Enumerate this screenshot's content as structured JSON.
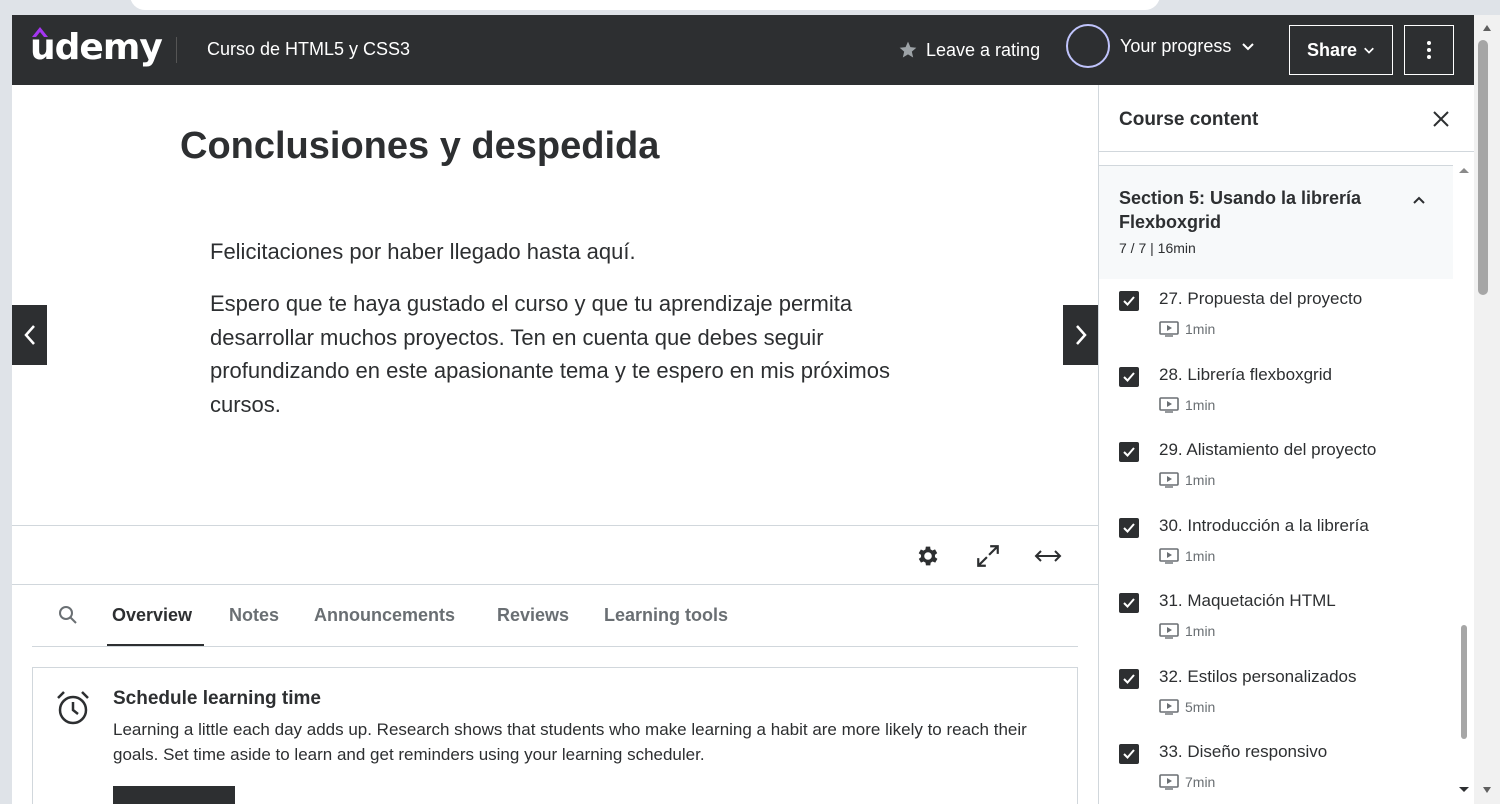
{
  "header": {
    "logo_text": "udemy",
    "course_title": "Curso de HTML5 y CSS3",
    "leave_rating": "Leave a rating",
    "your_progress": "Your progress",
    "share": "Share"
  },
  "lecture": {
    "title": "Conclusiones y despedida",
    "paragraph1": "Felicitaciones por haber llegado hasta aquí.",
    "paragraph2": "Espero que te haya gustado el curso y que tu aprendizaje permita desarrollar muchos proyectos. Ten en cuenta que debes seguir profundizando en este apasionante tema y te espero en mis próximos cursos."
  },
  "tabs": {
    "overview": "Overview",
    "notes": "Notes",
    "announcements": "Announcements",
    "reviews": "Reviews",
    "learning_tools": "Learning tools"
  },
  "schedule": {
    "title": "Schedule learning time",
    "text": "Learning a little each day adds up. Research shows that students who make learning a habit are more likely to reach their goals. Set time aside to learn and get reminders using your learning scheduler."
  },
  "sidebar": {
    "title": "Course content",
    "section": {
      "title": "Section 5: Usando la librería Flexboxgrid",
      "meta": "7 / 7 | 16min"
    },
    "lessons": [
      {
        "title": "27. Propuesta del proyecto",
        "duration": "1min",
        "done": true
      },
      {
        "title": "28. Librería flexboxgrid",
        "duration": "1min",
        "done": true
      },
      {
        "title": "29. Alistamiento del proyecto",
        "duration": "1min",
        "done": true
      },
      {
        "title": "30. Introducción a la librería",
        "duration": "1min",
        "done": true
      },
      {
        "title": "31. Maquetación HTML",
        "duration": "1min",
        "done": true
      },
      {
        "title": "32. Estilos personalizados",
        "duration": "5min",
        "done": true
      },
      {
        "title": "33. Diseño responsivo",
        "duration": "7min",
        "done": true
      }
    ]
  },
  "icons": {
    "star": "star-icon",
    "chevron": "chevron-down-icon",
    "more": "more-vertical-icon",
    "close": "close-icon",
    "prev": "chevron-left-icon",
    "next": "chevron-right-icon",
    "settings": "gear-icon",
    "fullscreen": "expand-icon",
    "wide": "arrows-horizontal-icon",
    "search": "search-icon",
    "alarm": "alarm-clock-icon",
    "video": "video-icon"
  },
  "colors": {
    "header_bg": "#2d2f31",
    "brand_purple": "#a435f0",
    "progress_ring": "#c0c4fc"
  }
}
